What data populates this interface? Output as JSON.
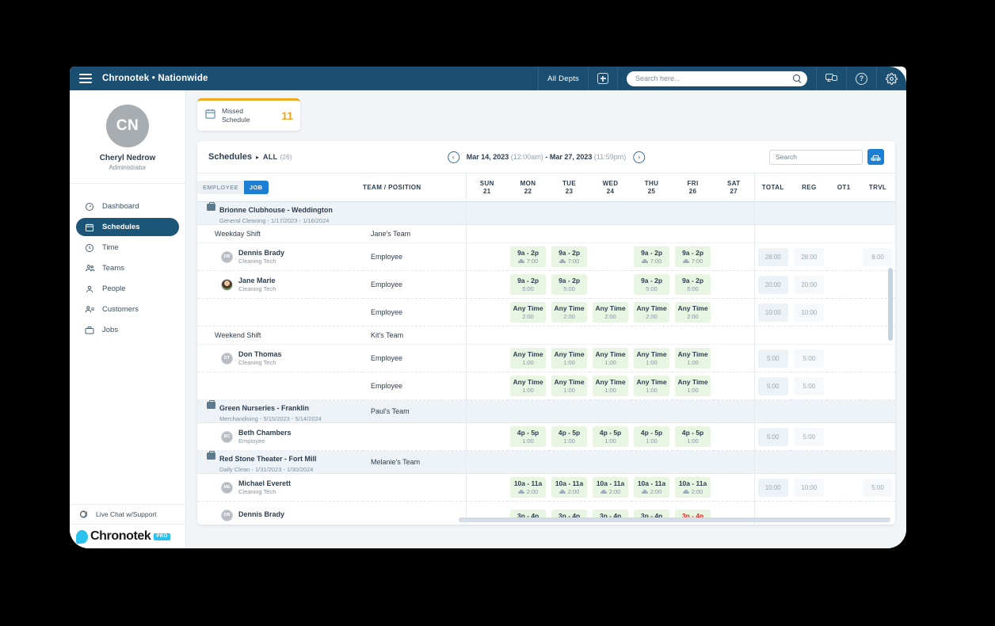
{
  "appbar": {
    "title": "Chronotek • Nationwide",
    "menu_icon": "hamburger-icon",
    "depts_label": "All Depts",
    "add_icon": "plus-square-icon",
    "search_placeholder": "Search here...",
    "search_value": "",
    "chat_icon": "chat-icon",
    "help_icon": "help-icon",
    "gear_icon": "gear-icon",
    "bg_color": "#1b4f72"
  },
  "sidebar": {
    "avatar_initials": "CN",
    "user_name": "Cheryl Nedrow",
    "user_role": "Administrator",
    "items": [
      {
        "label": "Dashboard",
        "icon": "dashboard-icon",
        "active": false
      },
      {
        "label": "Schedules",
        "icon": "calendar-icon",
        "active": true
      },
      {
        "label": "Time",
        "icon": "clock-icon",
        "active": false
      },
      {
        "label": "Teams",
        "icon": "teams-icon",
        "active": false
      },
      {
        "label": "People",
        "icon": "person-icon",
        "active": false
      },
      {
        "label": "Customers",
        "icon": "customers-icon",
        "active": false
      },
      {
        "label": "Jobs",
        "icon": "briefcase-icon",
        "active": false
      }
    ],
    "live_chat_label": "Live Chat w/Support",
    "brand_name": "Chronotek",
    "brand_badge": "PRO",
    "active_color": "#1b5679"
  },
  "kpi": {
    "icon": "calendar-icon",
    "label_line1": "Missed",
    "label_line2": "Schedule",
    "value": "11",
    "accent_color": "#f0a81e"
  },
  "toolbar": {
    "title": "Schedules",
    "separator": "▸",
    "scope": "ALL",
    "scope_count": "(26)",
    "prev_icon": "chevron-left-icon",
    "next_icon": "chevron-right-icon",
    "date_start": "Mar 14, 2023",
    "date_start_time": "(12:00am)",
    "date_dash": "-",
    "date_end": "Mar 27, 2023",
    "date_end_time": "(11:59pm)",
    "search_placeholder": "Search",
    "search_value": "",
    "travel_icon": "car-icon",
    "travel_btn_color": "#1d7fd4"
  },
  "table": {
    "toggle": {
      "left_label": "EMPLOYEE",
      "right_label": "JOB",
      "active": "JOB"
    },
    "col_team": "TEAM / POSITION",
    "days": [
      {
        "dow": "SUN",
        "num": "21"
      },
      {
        "dow": "MON",
        "num": "22"
      },
      {
        "dow": "TUE",
        "num": "23"
      },
      {
        "dow": "WED",
        "num": "24"
      },
      {
        "dow": "THU",
        "num": "25"
      },
      {
        "dow": "FRI",
        "num": "26"
      },
      {
        "dow": "SAT",
        "num": "27"
      }
    ],
    "col_total": "TOTAL",
    "col_reg": "REG",
    "col_ot1": "OT1",
    "col_trvl": "TRVL",
    "rows": [
      {
        "kind": "group",
        "name": "Brionne Clubhouse - Weddington",
        "sub": "General Cleaning  -  1/17/2023  -  1/16/2024",
        "team": ""
      },
      {
        "kind": "shift",
        "name": "Weekday Shift",
        "team": "Jane's Team"
      },
      {
        "kind": "employee",
        "avatar": "DB",
        "avatar_type": "initials",
        "name": "Dennis Brady",
        "role": "Cleaning Tech",
        "position": "Employee",
        "cells": [
          null,
          {
            "time": "9a - 2p",
            "dur": "7:00",
            "car": true
          },
          {
            "time": "9a - 2p",
            "dur": "7:00",
            "car": true
          },
          null,
          {
            "time": "9a - 2p",
            "dur": "7:00",
            "car": true
          },
          {
            "time": "9a - 2p",
            "dur": "7:00",
            "car": true
          },
          null
        ],
        "total": "28:00",
        "reg": "28:00",
        "ot1": "",
        "trvl": "8:00"
      },
      {
        "kind": "employee",
        "avatar": "JM",
        "avatar_type": "photo",
        "name": "Jane Marie",
        "role": "Cleaning Tech",
        "position": "Employee",
        "cells": [
          null,
          {
            "time": "9a - 2p",
            "dur": "5:00",
            "car": false
          },
          {
            "time": "9a - 2p",
            "dur": "5:00",
            "car": false
          },
          null,
          {
            "time": "9a - 2p",
            "dur": "5:00",
            "car": false
          },
          {
            "time": "9a - 2p",
            "dur": "5:00",
            "car": false
          },
          null
        ],
        "total": "20:00",
        "reg": "20:00",
        "ot1": "",
        "trvl": ""
      },
      {
        "kind": "employee",
        "avatar": "",
        "avatar_type": "none",
        "name": "",
        "role": "",
        "position": "Employee",
        "cells": [
          null,
          {
            "time": "Any Time",
            "dur": "2:00",
            "car": false
          },
          {
            "time": "Any Time",
            "dur": "2:00",
            "car": false
          },
          {
            "time": "Any Time",
            "dur": "2:00",
            "car": false
          },
          {
            "time": "Any Time",
            "dur": "2:00",
            "car": false
          },
          {
            "time": "Any Time",
            "dur": "2:00",
            "car": false
          },
          null
        ],
        "total": "10:00",
        "reg": "10:00",
        "ot1": "",
        "trvl": ""
      },
      {
        "kind": "shift",
        "name": "Weekend Shift",
        "team": "Kit's Team"
      },
      {
        "kind": "employee",
        "avatar": "DT",
        "avatar_type": "initials",
        "name": "Don Thomas",
        "role": "Cleaning Tech",
        "position": "Employee",
        "cells": [
          null,
          {
            "time": "Any Time",
            "dur": "1:00",
            "car": false
          },
          {
            "time": "Any Time",
            "dur": "1:00",
            "car": false
          },
          {
            "time": "Any Time",
            "dur": "1:00",
            "car": false
          },
          {
            "time": "Any Time",
            "dur": "1:00",
            "car": false
          },
          {
            "time": "Any Time",
            "dur": "1:00",
            "car": false
          },
          null
        ],
        "total": "5:00",
        "reg": "5:00",
        "ot1": "",
        "trvl": ""
      },
      {
        "kind": "employee",
        "avatar": "",
        "avatar_type": "none",
        "name": "",
        "role": "",
        "position": "Employee",
        "cells": [
          null,
          {
            "time": "Any Time",
            "dur": "1:00",
            "car": false
          },
          {
            "time": "Any Time",
            "dur": "1:00",
            "car": false
          },
          {
            "time": "Any Time",
            "dur": "1:00",
            "car": false
          },
          {
            "time": "Any Time",
            "dur": "1:00",
            "car": false
          },
          {
            "time": "Any Time",
            "dur": "1:00",
            "car": false
          },
          null
        ],
        "total": "5:00",
        "reg": "5:00",
        "ot1": "",
        "trvl": ""
      },
      {
        "kind": "group",
        "name": "Green Nurseries - Franklin",
        "sub": "Merchandising  -  5/15/2023  -  5/14/2024",
        "team": "Paul's Team"
      },
      {
        "kind": "employee",
        "avatar": "BC",
        "avatar_type": "initials",
        "name": "Beth Chambers",
        "role": "Employee",
        "position": "",
        "cells": [
          null,
          {
            "time": "4p - 5p",
            "dur": "1:00",
            "car": false
          },
          {
            "time": "4p - 5p",
            "dur": "1:00",
            "car": false
          },
          {
            "time": "4p - 5p",
            "dur": "1:00",
            "car": false
          },
          {
            "time": "4p - 5p",
            "dur": "1:00",
            "car": false
          },
          {
            "time": "4p - 5p",
            "dur": "1:00",
            "car": false
          },
          null
        ],
        "total": "5:00",
        "reg": "5:00",
        "ot1": "",
        "trvl": ""
      },
      {
        "kind": "group",
        "name": "Red Stone Theater - Fort Mill",
        "sub": "Daily Clean  -  1/31/2023  -  1/30/2024",
        "team": "Melanie's Team"
      },
      {
        "kind": "employee",
        "avatar": "ME",
        "avatar_type": "initials",
        "name": "Michael Everett",
        "role": "Cleaning Tech",
        "position": "",
        "cells": [
          null,
          {
            "time": "10a - 11a",
            "dur": "2:00",
            "car": true
          },
          {
            "time": "10a - 11a",
            "dur": "2:00",
            "car": true
          },
          {
            "time": "10a - 11a",
            "dur": "2:00",
            "car": true
          },
          {
            "time": "10a - 11a",
            "dur": "2:00",
            "car": true
          },
          {
            "time": "10a - 11a",
            "dur": "2:00",
            "car": true
          },
          null
        ],
        "total": "10:00",
        "reg": "10:00",
        "ot1": "",
        "trvl": "5:00"
      },
      {
        "kind": "employee",
        "avatar": "DB",
        "avatar_type": "initials",
        "name": "Dennis Brady",
        "role": "",
        "position": "",
        "cells": [
          null,
          {
            "time": "3p - 4p",
            "dur": "",
            "car": false
          },
          {
            "time": "3p - 4p",
            "dur": "",
            "car": false
          },
          {
            "time": "3p - 4p",
            "dur": "",
            "car": false
          },
          {
            "time": "3p - 4p",
            "dur": "",
            "car": false
          },
          {
            "time": "3p - 4p",
            "dur": "",
            "car": false,
            "red": true
          },
          null
        ],
        "total": "",
        "reg": "",
        "ot1": "",
        "trvl": ""
      }
    ]
  }
}
